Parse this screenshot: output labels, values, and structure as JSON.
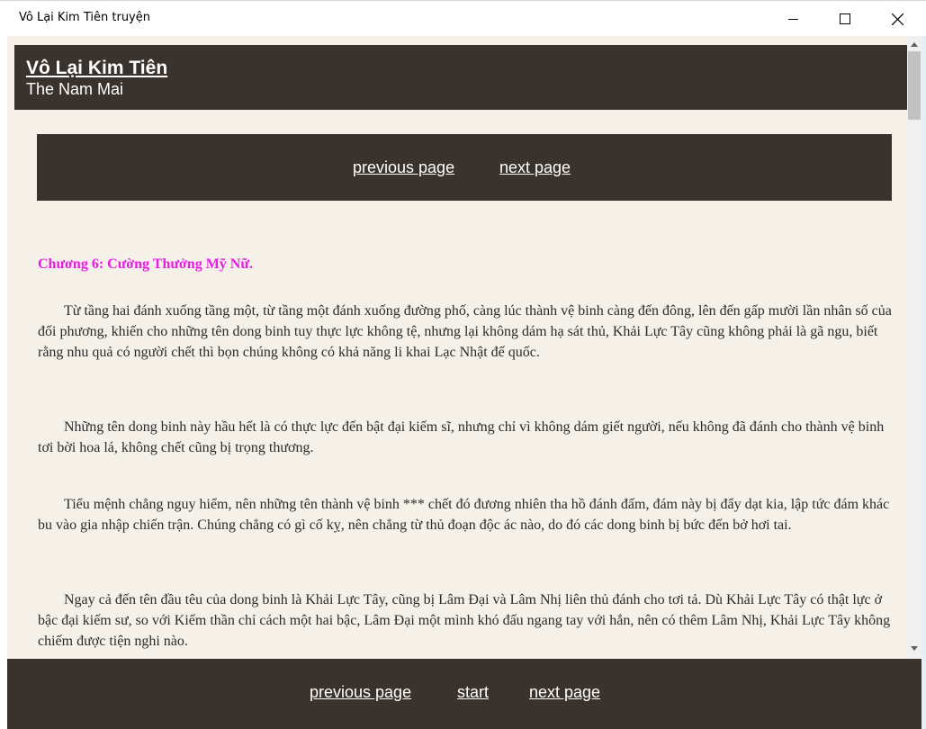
{
  "window": {
    "title": "Vô Lại Kim Tiên truyện"
  },
  "header": {
    "book_title": "Vô Lại Kim Tiên",
    "author": "The Nam Mai"
  },
  "top_nav": {
    "previous": "previous page",
    "next": "next page"
  },
  "chapter": {
    "title": "Chương 6: Cường Thưởng Mỹ Nữ.",
    "paragraphs": [
      "Từ tầng hai đánh xuống tầng một, từ tầng một đánh xuống đường phố, càng lúc thành vệ binh càng đến đông, lên đến gấp mười lần nhân số của đối phương, khiến cho những tên dong binh tuy thực lực không tệ, nhưng lại không dám hạ sát thủ, Khải Lực Tây cũng không phải là gã ngu, biết rằng nhu quả có người chết thì bọn chúng không có khả năng li khai Lạc Nhật đế quốc.",
      "Những tên dong binh này hầu hết là có thực lực đến bật đại kiếm sĩ, nhưng chỉ vì không dám giết người, nếu không đã đánh cho thành vệ binh tơi bời hoa lá, không chết cũng bị trọng thương.",
      "Tiểu mệnh chẳng nguy hiểm, nên những tên thành vệ binh *** chết đó đương nhiên tha hồ đánh đấm, đám này bị đẩy dạt kia, lập tức đám khác bu vào gia nhập chiến trận. Chúng chẳng có gì cố kỵ, nên chẳng từ thủ đoạn độc ác nào, do đó các dong binh bị bức đến bở hơi tai.",
      "Ngay cả đến tên đầu têu của dong binh là Khải Lực Tây, cũng bị Lâm Đại và Lâm Nhị liên thủ đánh cho tơi tả. Dù Khải Lực Tây có thật lực ở bậc đại kiếm sư, so với Kiếm thần chỉ cách một hai bậc, Lâm Đại một mình khó đấu ngang tay với hắn, nên có thêm Lâm Nhị, Khải Lực Tây không chiếm được tiện nghi nào."
    ]
  },
  "bottom_nav": {
    "previous": "previous page",
    "start": "start",
    "next": "next page"
  },
  "colors": {
    "panel": "#3a322c",
    "page_bg": "#f5f1e8",
    "chapter_title": "#e81ae6"
  },
  "icons": [
    "minimize-icon",
    "maximize-icon",
    "close-icon",
    "scroll-up-icon",
    "scroll-down-icon"
  ]
}
